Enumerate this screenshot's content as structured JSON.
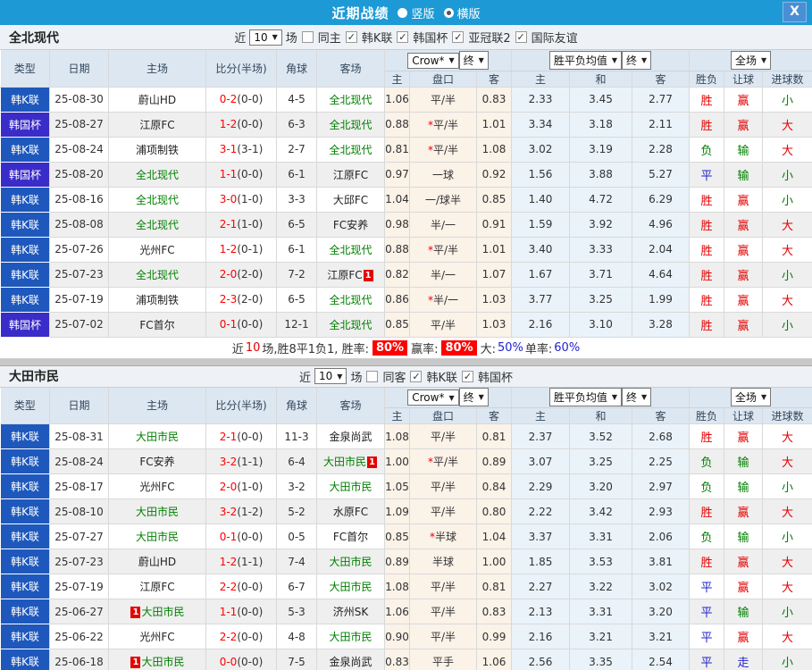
{
  "titlebar": {
    "title": "近期战绩",
    "radios": [
      {
        "label": "竖版",
        "selected": false
      },
      {
        "label": "横版",
        "selected": true
      }
    ],
    "close_label": "X"
  },
  "colors": {
    "topbar": "#1d9ad6",
    "kleague_badge": "#1e58bc",
    "cup_badge": "#3a2cc8",
    "team_green": "#008000",
    "score_red": "#ff0000",
    "summary_chip_bg": "#ff0000",
    "percent_blue": "#0000ee",
    "text": {
      "r": "#e60000",
      "g": "#008000",
      "b": "#2222cc"
    }
  },
  "sections": [
    {
      "team": "全北现代",
      "filter": {
        "pre": "近",
        "count": "10",
        "post": "场",
        "same": {
          "label": "同主",
          "checked": false
        },
        "leagues": [
          {
            "label": "韩K联",
            "checked": true
          },
          {
            "label": "韩国杯",
            "checked": true
          },
          {
            "label": "亚冠联2",
            "checked": true
          },
          {
            "label": "国际友谊",
            "checked": true
          }
        ]
      },
      "header": {
        "cols": [
          "类型",
          "日期",
          "主场",
          "比分(半场)",
          "角球",
          "客场"
        ],
        "groups": [
          {
            "selects": [
              "Crow*",
              "终"
            ],
            "subs": [
              "主",
              "盘口",
              "客"
            ]
          },
          {
            "selects": [
              "胜平负均值",
              "终"
            ],
            "subs": [
              "主",
              "和",
              "客"
            ]
          },
          {
            "selects": [
              "全场"
            ],
            "subs": [
              "胜负",
              "让球",
              "进球数"
            ]
          }
        ]
      },
      "rows": [
        {
          "league": "韩K联",
          "lc": "k",
          "date": "25-08-30",
          "home": {
            "t": "蔚山HD"
          },
          "score": "0-2",
          "half": "(0-0)",
          "corner": "4-5",
          "away": {
            "t": "全北现代",
            "g": 1
          },
          "o": [
            "1.06",
            "平/半",
            "0.83"
          ],
          "a": [
            "2.33",
            "3.45",
            "2.77"
          ],
          "r": [
            [
              "胜",
              "r"
            ],
            [
              "赢",
              "r"
            ],
            [
              "小",
              "g"
            ]
          ]
        },
        {
          "league": "韩国杯",
          "lc": "c",
          "date": "25-08-27",
          "home": {
            "t": "江原FC"
          },
          "score": "1-2",
          "half": "(0-0)",
          "corner": "6-3",
          "away": {
            "t": "全北现代",
            "g": 1
          },
          "o": [
            "0.88",
            "*平/半",
            "1.01"
          ],
          "a": [
            "3.34",
            "3.18",
            "2.11"
          ],
          "r": [
            [
              "胜",
              "r"
            ],
            [
              "赢",
              "r"
            ],
            [
              "大",
              "r"
            ]
          ]
        },
        {
          "league": "韩K联",
          "lc": "k",
          "date": "25-08-24",
          "home": {
            "t": "浦项制铁"
          },
          "score": "3-1",
          "half": "(3-1)",
          "corner": "2-7",
          "away": {
            "t": "全北现代",
            "g": 1
          },
          "o": [
            "0.81",
            "*平/半",
            "1.08"
          ],
          "a": [
            "3.02",
            "3.19",
            "2.28"
          ],
          "r": [
            [
              "负",
              "g"
            ],
            [
              "输",
              "g"
            ],
            [
              "大",
              "r"
            ]
          ]
        },
        {
          "league": "韩国杯",
          "lc": "c",
          "date": "25-08-20",
          "home": {
            "t": "全北现代",
            "g": 1
          },
          "score": "1-1",
          "half": "(0-0)",
          "corner": "6-1",
          "away": {
            "t": "江原FC"
          },
          "o": [
            "0.97",
            "一球",
            "0.92"
          ],
          "a": [
            "1.56",
            "3.88",
            "5.27"
          ],
          "r": [
            [
              "平",
              "b"
            ],
            [
              "输",
              "g"
            ],
            [
              "小",
              "g"
            ]
          ]
        },
        {
          "league": "韩K联",
          "lc": "k",
          "date": "25-08-16",
          "home": {
            "t": "全北现代",
            "g": 1
          },
          "score": "3-0",
          "half": "(1-0)",
          "corner": "3-3",
          "away": {
            "t": "大邱FC"
          },
          "o": [
            "1.04",
            "一/球半",
            "0.85"
          ],
          "a": [
            "1.40",
            "4.72",
            "6.29"
          ],
          "r": [
            [
              "胜",
              "r"
            ],
            [
              "赢",
              "r"
            ],
            [
              "小",
              "g"
            ]
          ]
        },
        {
          "league": "韩K联",
          "lc": "k",
          "date": "25-08-08",
          "home": {
            "t": "全北现代",
            "g": 1
          },
          "score": "2-1",
          "half": "(1-0)",
          "corner": "6-5",
          "away": {
            "t": "FC安养"
          },
          "o": [
            "0.98",
            "半/一",
            "0.91"
          ],
          "a": [
            "1.59",
            "3.92",
            "4.96"
          ],
          "r": [
            [
              "胜",
              "r"
            ],
            [
              "赢",
              "r"
            ],
            [
              "大",
              "r"
            ]
          ]
        },
        {
          "league": "韩K联",
          "lc": "k",
          "date": "25-07-26",
          "home": {
            "t": "光州FC"
          },
          "score": "1-2",
          "half": "(0-1)",
          "corner": "6-1",
          "away": {
            "t": "全北现代",
            "g": 1
          },
          "o": [
            "0.88",
            "*平/半",
            "1.01"
          ],
          "a": [
            "3.40",
            "3.33",
            "2.04"
          ],
          "r": [
            [
              "胜",
              "r"
            ],
            [
              "赢",
              "r"
            ],
            [
              "大",
              "r"
            ]
          ]
        },
        {
          "league": "韩K联",
          "lc": "k",
          "date": "25-07-23",
          "home": {
            "t": "全北现代",
            "g": 1
          },
          "score": "2-0",
          "half": "(2-0)",
          "corner": "7-2",
          "away": {
            "t": "江原FC",
            "b": "1",
            "bp": "after"
          },
          "o": [
            "0.82",
            "半/一",
            "1.07"
          ],
          "a": [
            "1.67",
            "3.71",
            "4.64"
          ],
          "r": [
            [
              "胜",
              "r"
            ],
            [
              "赢",
              "r"
            ],
            [
              "小",
              "g"
            ]
          ]
        },
        {
          "league": "韩K联",
          "lc": "k",
          "date": "25-07-19",
          "home": {
            "t": "浦项制铁"
          },
          "score": "2-3",
          "half": "(2-0)",
          "corner": "6-5",
          "away": {
            "t": "全北现代",
            "g": 1
          },
          "o": [
            "0.86",
            "*半/一",
            "1.03"
          ],
          "a": [
            "3.77",
            "3.25",
            "1.99"
          ],
          "r": [
            [
              "胜",
              "r"
            ],
            [
              "赢",
              "r"
            ],
            [
              "大",
              "r"
            ]
          ]
        },
        {
          "league": "韩国杯",
          "lc": "c",
          "date": "25-07-02",
          "home": {
            "t": "FC首尔"
          },
          "score": "0-1",
          "half": "(0-0)",
          "corner": "12-1",
          "away": {
            "t": "全北现代",
            "g": 1
          },
          "o": [
            "0.85",
            "平/半",
            "1.03"
          ],
          "a": [
            "2.16",
            "3.10",
            "3.28"
          ],
          "r": [
            [
              "胜",
              "r"
            ],
            [
              "赢",
              "r"
            ],
            [
              "小",
              "g"
            ]
          ]
        }
      ],
      "summary": [
        {
          "t": "近"
        },
        {
          "t": "10",
          "c": "r"
        },
        {
          "t": "场,胜8平1负1, 胜率:"
        },
        {
          "t": "80%",
          "bg": true
        },
        {
          "t": "赢率:"
        },
        {
          "t": "80%",
          "bg": true
        },
        {
          "t": "大:"
        },
        {
          "t": "50%",
          "c": "b"
        },
        {
          "t": " 单率:"
        },
        {
          "t": "60%",
          "c": "b"
        }
      ]
    },
    {
      "team": "大田市民",
      "filter": {
        "pre": "近",
        "count": "10",
        "post": "场",
        "same": {
          "label": "同客",
          "checked": false
        },
        "leagues": [
          {
            "label": "韩K联",
            "checked": true
          },
          {
            "label": "韩国杯",
            "checked": true
          }
        ]
      },
      "header": {
        "cols": [
          "类型",
          "日期",
          "主场",
          "比分(半场)",
          "角球",
          "客场"
        ],
        "groups": [
          {
            "selects": [
              "Crow*",
              "终"
            ],
            "subs": [
              "主",
              "盘口",
              "客"
            ]
          },
          {
            "selects": [
              "胜平负均值",
              "终"
            ],
            "subs": [
              "主",
              "和",
              "客"
            ]
          },
          {
            "selects": [
              "全场"
            ],
            "subs": [
              "胜负",
              "让球",
              "进球数"
            ]
          }
        ]
      },
      "rows": [
        {
          "league": "韩K联",
          "lc": "k",
          "date": "25-08-31",
          "home": {
            "t": "大田市民",
            "g": 1
          },
          "score": "2-1",
          "half": "(0-0)",
          "corner": "11-3",
          "away": {
            "t": "金泉尚武"
          },
          "o": [
            "1.08",
            "平/半",
            "0.81"
          ],
          "a": [
            "2.37",
            "3.52",
            "2.68"
          ],
          "r": [
            [
              "胜",
              "r"
            ],
            [
              "赢",
              "r"
            ],
            [
              "大",
              "r"
            ]
          ]
        },
        {
          "league": "韩K联",
          "lc": "k",
          "date": "25-08-24",
          "home": {
            "t": "FC安养"
          },
          "score": "3-2",
          "half": "(1-1)",
          "corner": "6-4",
          "away": {
            "t": "大田市民",
            "g": 1,
            "b": "1",
            "bp": "after"
          },
          "o": [
            "1.00",
            "*平/半",
            "0.89"
          ],
          "a": [
            "3.07",
            "3.25",
            "2.25"
          ],
          "r": [
            [
              "负",
              "g"
            ],
            [
              "输",
              "g"
            ],
            [
              "大",
              "r"
            ]
          ]
        },
        {
          "league": "韩K联",
          "lc": "k",
          "date": "25-08-17",
          "home": {
            "t": "光州FC"
          },
          "score": "2-0",
          "half": "(1-0)",
          "corner": "3-2",
          "away": {
            "t": "大田市民",
            "g": 1
          },
          "o": [
            "1.05",
            "平/半",
            "0.84"
          ],
          "a": [
            "2.29",
            "3.20",
            "2.97"
          ],
          "r": [
            [
              "负",
              "g"
            ],
            [
              "输",
              "g"
            ],
            [
              "小",
              "g"
            ]
          ]
        },
        {
          "league": "韩K联",
          "lc": "k",
          "date": "25-08-10",
          "home": {
            "t": "大田市民",
            "g": 1
          },
          "score": "3-2",
          "half": "(1-2)",
          "corner": "5-2",
          "away": {
            "t": "水原FC"
          },
          "o": [
            "1.09",
            "平/半",
            "0.80"
          ],
          "a": [
            "2.22",
            "3.42",
            "2.93"
          ],
          "r": [
            [
              "胜",
              "r"
            ],
            [
              "赢",
              "r"
            ],
            [
              "大",
              "r"
            ]
          ]
        },
        {
          "league": "韩K联",
          "lc": "k",
          "date": "25-07-27",
          "home": {
            "t": "大田市民",
            "g": 1
          },
          "score": "0-1",
          "half": "(0-0)",
          "corner": "0-5",
          "away": {
            "t": "FC首尔"
          },
          "o": [
            "0.85",
            "*半球",
            "1.04"
          ],
          "a": [
            "3.37",
            "3.31",
            "2.06"
          ],
          "r": [
            [
              "负",
              "g"
            ],
            [
              "输",
              "g"
            ],
            [
              "小",
              "g"
            ]
          ]
        },
        {
          "league": "韩K联",
          "lc": "k",
          "date": "25-07-23",
          "home": {
            "t": "蔚山HD"
          },
          "score": "1-2",
          "half": "(1-1)",
          "corner": "7-4",
          "away": {
            "t": "大田市民",
            "g": 1
          },
          "o": [
            "0.89",
            "半球",
            "1.00"
          ],
          "a": [
            "1.85",
            "3.53",
            "3.81"
          ],
          "r": [
            [
              "胜",
              "r"
            ],
            [
              "赢",
              "r"
            ],
            [
              "大",
              "r"
            ]
          ]
        },
        {
          "league": "韩K联",
          "lc": "k",
          "date": "25-07-19",
          "home": {
            "t": "江原FC"
          },
          "score": "2-2",
          "half": "(0-0)",
          "corner": "6-7",
          "away": {
            "t": "大田市民",
            "g": 1
          },
          "o": [
            "1.08",
            "平/半",
            "0.81"
          ],
          "a": [
            "2.27",
            "3.22",
            "3.02"
          ],
          "r": [
            [
              "平",
              "b"
            ],
            [
              "赢",
              "r"
            ],
            [
              "大",
              "r"
            ]
          ]
        },
        {
          "league": "韩K联",
          "lc": "k",
          "date": "25-06-27",
          "home": {
            "t": "大田市民",
            "g": 1,
            "b": "1",
            "bp": "before"
          },
          "score": "1-1",
          "half": "(0-0)",
          "corner": "5-3",
          "away": {
            "t": "济州SK"
          },
          "o": [
            "1.06",
            "平/半",
            "0.83"
          ],
          "a": [
            "2.13",
            "3.31",
            "3.20"
          ],
          "r": [
            [
              "平",
              "b"
            ],
            [
              "输",
              "g"
            ],
            [
              "小",
              "g"
            ]
          ]
        },
        {
          "league": "韩K联",
          "lc": "k",
          "date": "25-06-22",
          "home": {
            "t": "光州FC"
          },
          "score": "2-2",
          "half": "(0-0)",
          "corner": "4-8",
          "away": {
            "t": "大田市民",
            "g": 1
          },
          "o": [
            "0.90",
            "平/半",
            "0.99"
          ],
          "a": [
            "2.16",
            "3.21",
            "3.21"
          ],
          "r": [
            [
              "平",
              "b"
            ],
            [
              "赢",
              "r"
            ],
            [
              "大",
              "r"
            ]
          ]
        },
        {
          "league": "韩K联",
          "lc": "k",
          "date": "25-06-18",
          "home": {
            "t": "大田市民",
            "g": 1,
            "b": "1",
            "bp": "before"
          },
          "score": "0-0",
          "half": "(0-0)",
          "corner": "7-5",
          "away": {
            "t": "金泉尚武"
          },
          "o": [
            "0.83",
            "平手",
            "1.06"
          ],
          "a": [
            "2.56",
            "3.35",
            "2.54"
          ],
          "r": [
            [
              "平",
              "b"
            ],
            [
              "走",
              "b"
            ],
            [
              "小",
              "g"
            ]
          ]
        }
      ]
    }
  ]
}
